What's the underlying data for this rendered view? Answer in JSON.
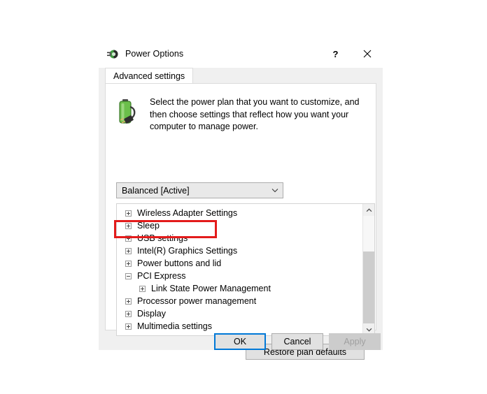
{
  "window": {
    "title": "Power Options",
    "icon": "power-plug-icon",
    "help_label": "?",
    "close_label": "✕"
  },
  "tabs": [
    {
      "label": "Advanced settings",
      "active": true
    }
  ],
  "blurb": {
    "icon": "battery-plug-icon",
    "text": "Select the power plan that you want to customize, and then choose settings that reflect how you want your computer to manage power."
  },
  "plan_combo": {
    "name": "power-plan-dropdown",
    "value": "Balanced [Active]",
    "arrow": "chevron-down-icon"
  },
  "tree": {
    "items": [
      {
        "label": "Wireless Adapter Settings",
        "state": "collapsed",
        "level": 0
      },
      {
        "label": "Sleep",
        "state": "collapsed",
        "level": 0
      },
      {
        "label": "USB settings",
        "state": "collapsed",
        "level": 0
      },
      {
        "label": "Intel(R) Graphics Settings",
        "state": "collapsed",
        "level": 0
      },
      {
        "label": "Power buttons and lid",
        "state": "collapsed",
        "level": 0
      },
      {
        "label": "PCI Express",
        "state": "expanded",
        "level": 0,
        "highlighted": true
      },
      {
        "label": "Link State Power Management",
        "state": "collapsed",
        "level": 1
      },
      {
        "label": "Processor power management",
        "state": "collapsed",
        "level": 0
      },
      {
        "label": "Display",
        "state": "collapsed",
        "level": 0
      },
      {
        "label": "Multimedia settings",
        "state": "collapsed",
        "level": 0
      }
    ],
    "scrollbar": {
      "up_arrow": "chevron-up-icon",
      "down_arrow": "chevron-down-icon"
    }
  },
  "restore_button": {
    "label": "Restore plan defaults"
  },
  "footer": {
    "ok_label": "OK",
    "cancel_label": "Cancel",
    "apply_label": "Apply",
    "apply_disabled": true
  },
  "annotation": {
    "type": "rectangle-highlight",
    "color": "#e31b1b",
    "target": "PCI Express"
  }
}
